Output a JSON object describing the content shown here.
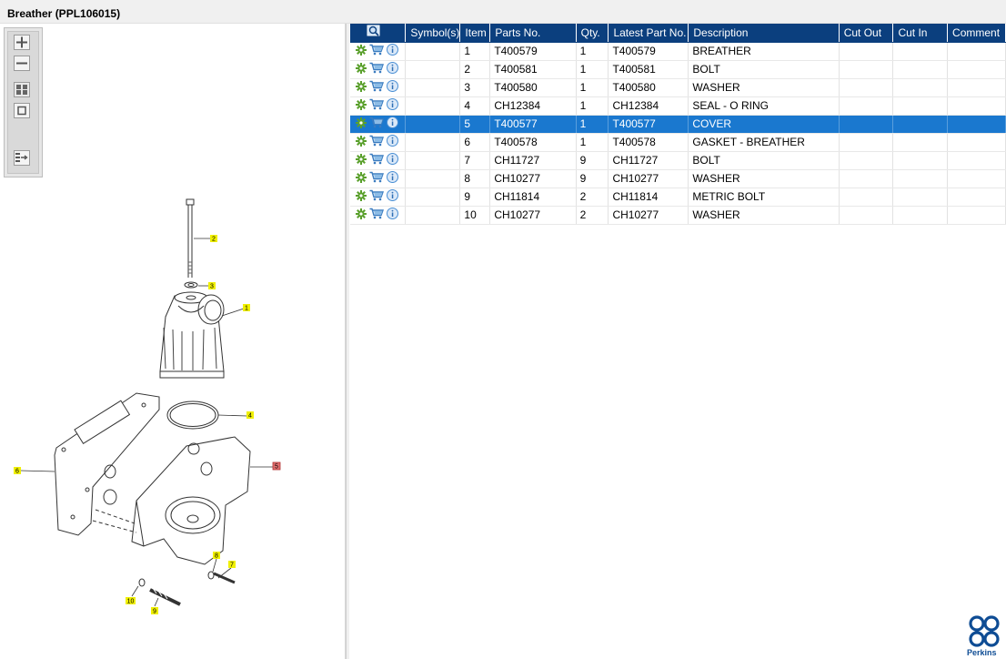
{
  "window": {
    "title": "Breather (PPL106015)"
  },
  "toolbar": {
    "buttons": [
      "zoom-in-icon",
      "zoom-out-icon",
      "fit-page-icon",
      "actual-size-icon",
      "list-view-icon"
    ]
  },
  "drawing": {
    "callouts": [
      "1",
      "2",
      "3",
      "4",
      "5",
      "6",
      "7",
      "8",
      "9",
      "10"
    ],
    "highlight_color": "#f0f000",
    "selected_color": "#e04040"
  },
  "table": {
    "headers": [
      "",
      "Symbol(s)",
      "Item",
      "Parts No.",
      "Qty.",
      "Latest Part No.",
      "Description",
      "Cut Out",
      "Cut In",
      "Comment"
    ],
    "rows": [
      {
        "item": "1",
        "parts_no": "T400579",
        "qty": "1",
        "latest": "T400579",
        "desc": "BREATHER"
      },
      {
        "item": "2",
        "parts_no": "T400581",
        "qty": "1",
        "latest": "T400581",
        "desc": "BOLT"
      },
      {
        "item": "3",
        "parts_no": "T400580",
        "qty": "1",
        "latest": "T400580",
        "desc": "WASHER"
      },
      {
        "item": "4",
        "parts_no": "CH12384",
        "qty": "1",
        "latest": "CH12384",
        "desc": "SEAL - O RING"
      },
      {
        "item": "5",
        "parts_no": "T400577",
        "qty": "1",
        "latest": "T400577",
        "desc": "COVER"
      },
      {
        "item": "6",
        "parts_no": "T400578",
        "qty": "1",
        "latest": "T400578",
        "desc": "GASKET - BREATHER"
      },
      {
        "item": "7",
        "parts_no": "CH11727",
        "qty": "9",
        "latest": "CH11727",
        "desc": "BOLT"
      },
      {
        "item": "8",
        "parts_no": "CH10277",
        "qty": "9",
        "latest": "CH10277",
        "desc": "WASHER"
      },
      {
        "item": "9",
        "parts_no": "CH11814",
        "qty": "2",
        "latest": "CH11814",
        "desc": "METRIC BOLT"
      },
      {
        "item": "10",
        "parts_no": "CH10277",
        "qty": "2",
        "latest": "CH10277",
        "desc": "WASHER"
      }
    ],
    "selected_item": "5"
  },
  "logo": {
    "text": "Perkins",
    "color": "#0e4c94"
  },
  "colors": {
    "header": "#0b3f7e",
    "selected_row": "#1a78cf",
    "gear": "#5aa02c",
    "cart": "#3a7bbf",
    "info": "#4a8fd4"
  }
}
